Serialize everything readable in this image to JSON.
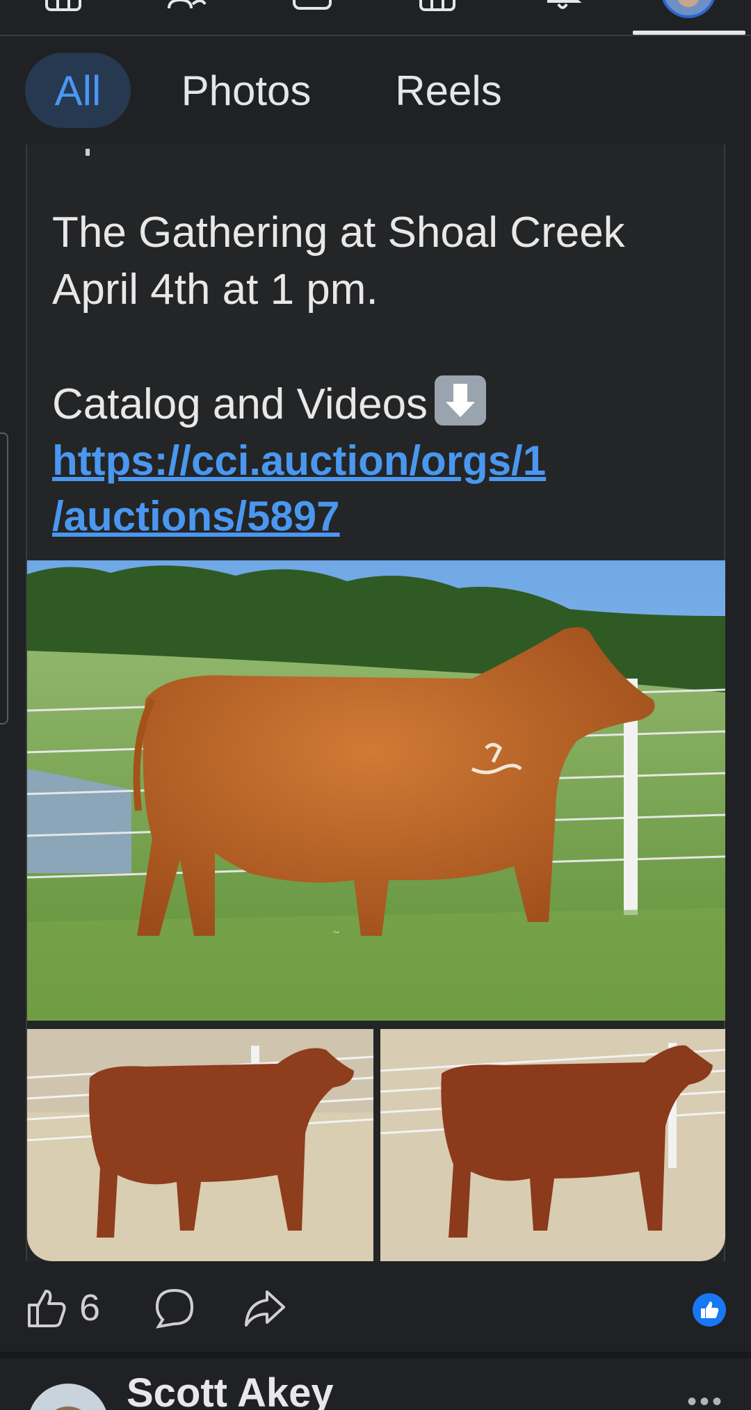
{
  "nav": {
    "icons": [
      "home-icon",
      "friends-icon",
      "video-icon",
      "marketplace-icon",
      "notifications-icon",
      "profile-avatar"
    ]
  },
  "filters": {
    "all": "All",
    "photos": "Photos",
    "reels": "Reels"
  },
  "post": {
    "line1": "The Gathering at Shoal Creek",
    "line2": "April 4th at 1 pm.",
    "line3": "Catalog and Videos",
    "link": "https://cci.auction/orgs/1/auctions/5897",
    "link_line1": "https://cci.auction/orgs/1",
    "link_line2": "/auctions/5897",
    "like_count": "6"
  },
  "next_post": {
    "author": "Scott Akey"
  },
  "colors": {
    "background": "#202124",
    "link": "#4a97f0",
    "accent": "#1877f2"
  }
}
